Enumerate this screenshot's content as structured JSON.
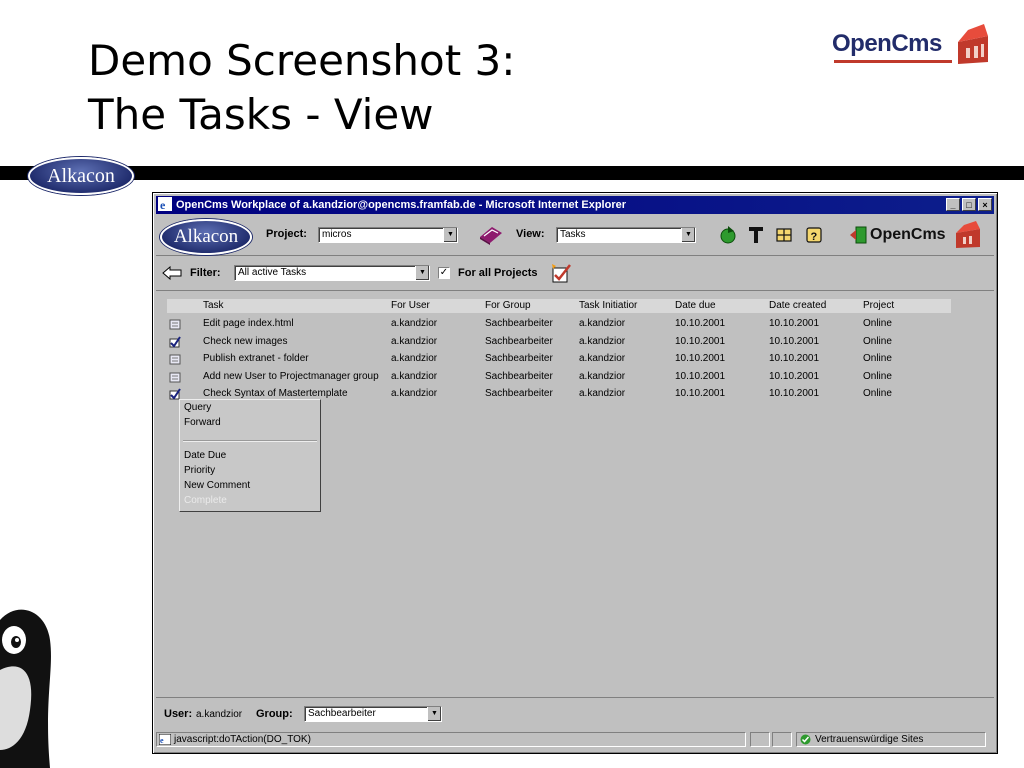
{
  "slide": {
    "title_line1": "Demo Screenshot 3:",
    "title_line2": "The Tasks - View",
    "logo_text": "OpenCms",
    "alkacon_logo": "Alkacon"
  },
  "window": {
    "title": "OpenCms Workplace of a.kandzior@opencms.framfab.de - Microsoft Internet Explorer",
    "buttons": [
      "_",
      "□",
      "×"
    ]
  },
  "toolbar": {
    "logo": "Alkacon",
    "project_label": "Project:",
    "project_value": "micros",
    "view_label": "View:",
    "view_value": "Tasks",
    "opencms_logo": "OpenCms",
    "icons": [
      "book-icon",
      "reload-icon",
      "tools-icon",
      "sync-icon",
      "help-icon",
      "exit-icon"
    ]
  },
  "filterbar": {
    "filter_label": "Filter:",
    "filter_value": "All active Tasks",
    "for_all_projects_label": "For all Projects",
    "for_all_projects_checked": true
  },
  "table": {
    "columns": [
      "Task",
      "For User",
      "For Group",
      "Task Initiatior",
      "Date due",
      "Date created",
      "Project"
    ],
    "rows": [
      {
        "checked": false,
        "task": "Edit page index.html",
        "user": "a.kandzior",
        "group": "Sachbearbeiter",
        "initiator": "a.kandzior",
        "due": "10.10.2001",
        "created": "10.10.2001",
        "project": "Online"
      },
      {
        "checked": true,
        "task": "Check new images",
        "user": "a.kandzior",
        "group": "Sachbearbeiter",
        "initiator": "a.kandzior",
        "due": "10.10.2001",
        "created": "10.10.2001",
        "project": "Online"
      },
      {
        "checked": false,
        "task": "Publish extranet - folder",
        "user": "a.kandzior",
        "group": "Sachbearbeiter",
        "initiator": "a.kandzior",
        "due": "10.10.2001",
        "created": "10.10.2001",
        "project": "Online"
      },
      {
        "checked": false,
        "task": "Add new User to Projectmanager group",
        "user": "a.kandzior",
        "group": "Sachbearbeiter",
        "initiator": "a.kandzior",
        "due": "10.10.2001",
        "created": "10.10.2001",
        "project": "Online"
      },
      {
        "checked": true,
        "task": "Check Syntax of Mastertemplate",
        "user": "a.kandzior",
        "group": "Sachbearbeiter",
        "initiator": "a.kandzior",
        "due": "10.10.2001",
        "created": "10.10.2001",
        "project": "Online"
      }
    ]
  },
  "context_menu": {
    "items": [
      "Query",
      "Forward",
      "Date Due",
      "Priority",
      "New Comment",
      "Complete"
    ]
  },
  "footer": {
    "user_label": "User:",
    "user_value": "a.kandzior",
    "group_label": "Group:",
    "group_value": "Sachbearbeiter"
  },
  "statusbar": {
    "text": "javascript:doTAction(DO_TOK)",
    "zone": "Vertrauenswürdige Sites"
  }
}
